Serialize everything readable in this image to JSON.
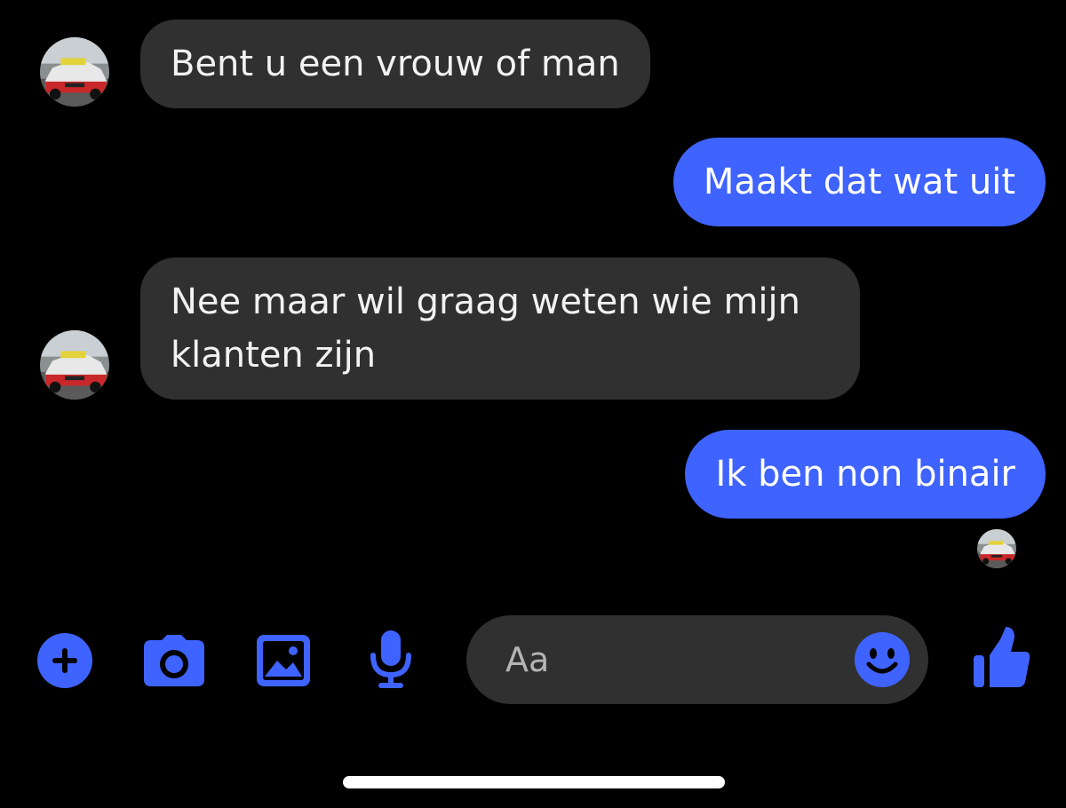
{
  "colors": {
    "background": "#000000",
    "received_bubble": "#303030",
    "sent_bubble": "#3f63ff",
    "accent": "#3f63ff"
  },
  "conversation": {
    "messages": [
      {
        "direction": "received",
        "text": "Bent u een vrouw of man"
      },
      {
        "direction": "sent",
        "text": "Maakt dat wat uit"
      },
      {
        "direction": "received",
        "lines": [
          "Nee maar wil graag weten wie mijn",
          "klanten zijn"
        ]
      },
      {
        "direction": "sent",
        "text": "Ik ben non binair"
      }
    ]
  },
  "toolbar": {
    "icons": [
      "plus-circle-icon",
      "camera-icon",
      "image-icon",
      "microphone-icon",
      "emoji-icon",
      "thumbs-up-icon"
    ]
  },
  "composer": {
    "placeholder": "Aa"
  }
}
